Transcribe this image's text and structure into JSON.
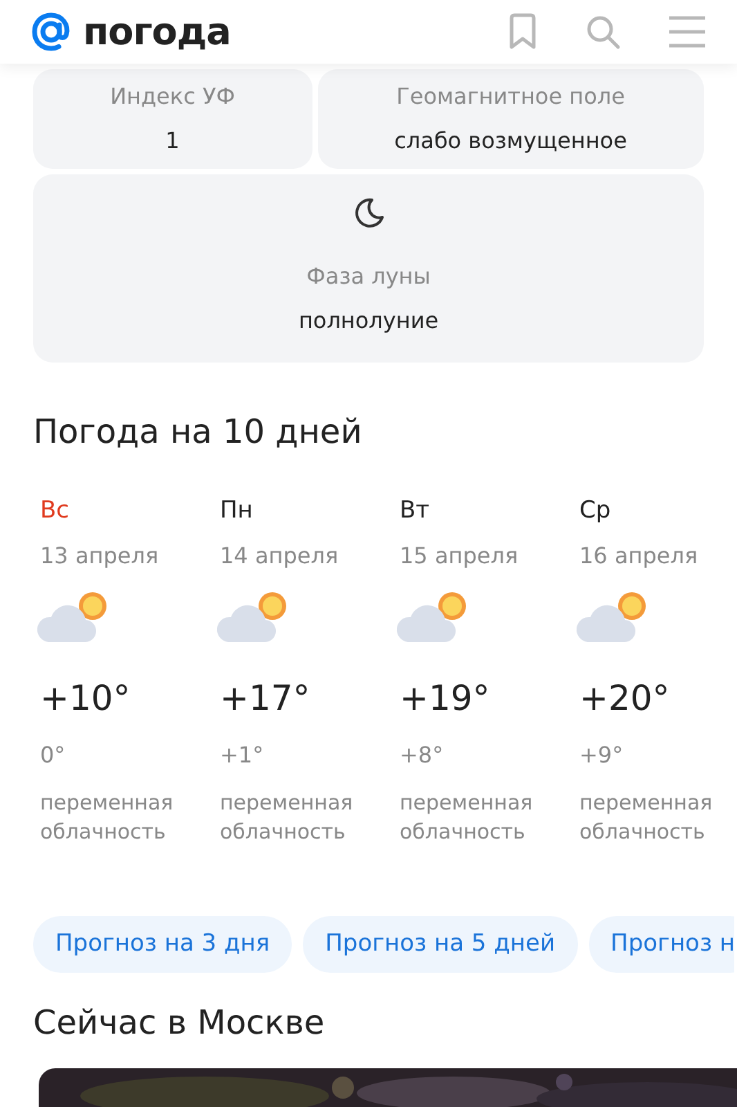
{
  "header": {
    "logo_text": "погода"
  },
  "info_cards": [
    {
      "label": "Индекс УФ",
      "value": "1"
    },
    {
      "label": "Геомагнитное поле",
      "value": "слабо возмущенное"
    }
  ],
  "moon_card": {
    "label": "Фаза луны",
    "value": "полнолуние"
  },
  "forecast": {
    "title": "Погода на 10 дней",
    "days": [
      {
        "weekday": "Вс",
        "weekend": true,
        "date": "13 апреля",
        "day_temp": "+10°",
        "night_temp": "0°",
        "condition": "переменная облачность"
      },
      {
        "weekday": "Пн",
        "weekend": false,
        "date": "14 апреля",
        "day_temp": "+17°",
        "night_temp": "+1°",
        "condition": "переменная облачность"
      },
      {
        "weekday": "Вт",
        "weekend": false,
        "date": "15 апреля",
        "day_temp": "+19°",
        "night_temp": "+8°",
        "condition": "переменная облачность"
      },
      {
        "weekday": "Ср",
        "weekend": false,
        "date": "16 апреля",
        "day_temp": "+20°",
        "night_temp": "+9°",
        "condition": "переменная облачность"
      }
    ]
  },
  "forecast_links": [
    "Прогноз на 3 дня",
    "Прогноз на 5 дней",
    "Прогноз н"
  ],
  "now_section": {
    "title": "Сейчас в Москве"
  }
}
